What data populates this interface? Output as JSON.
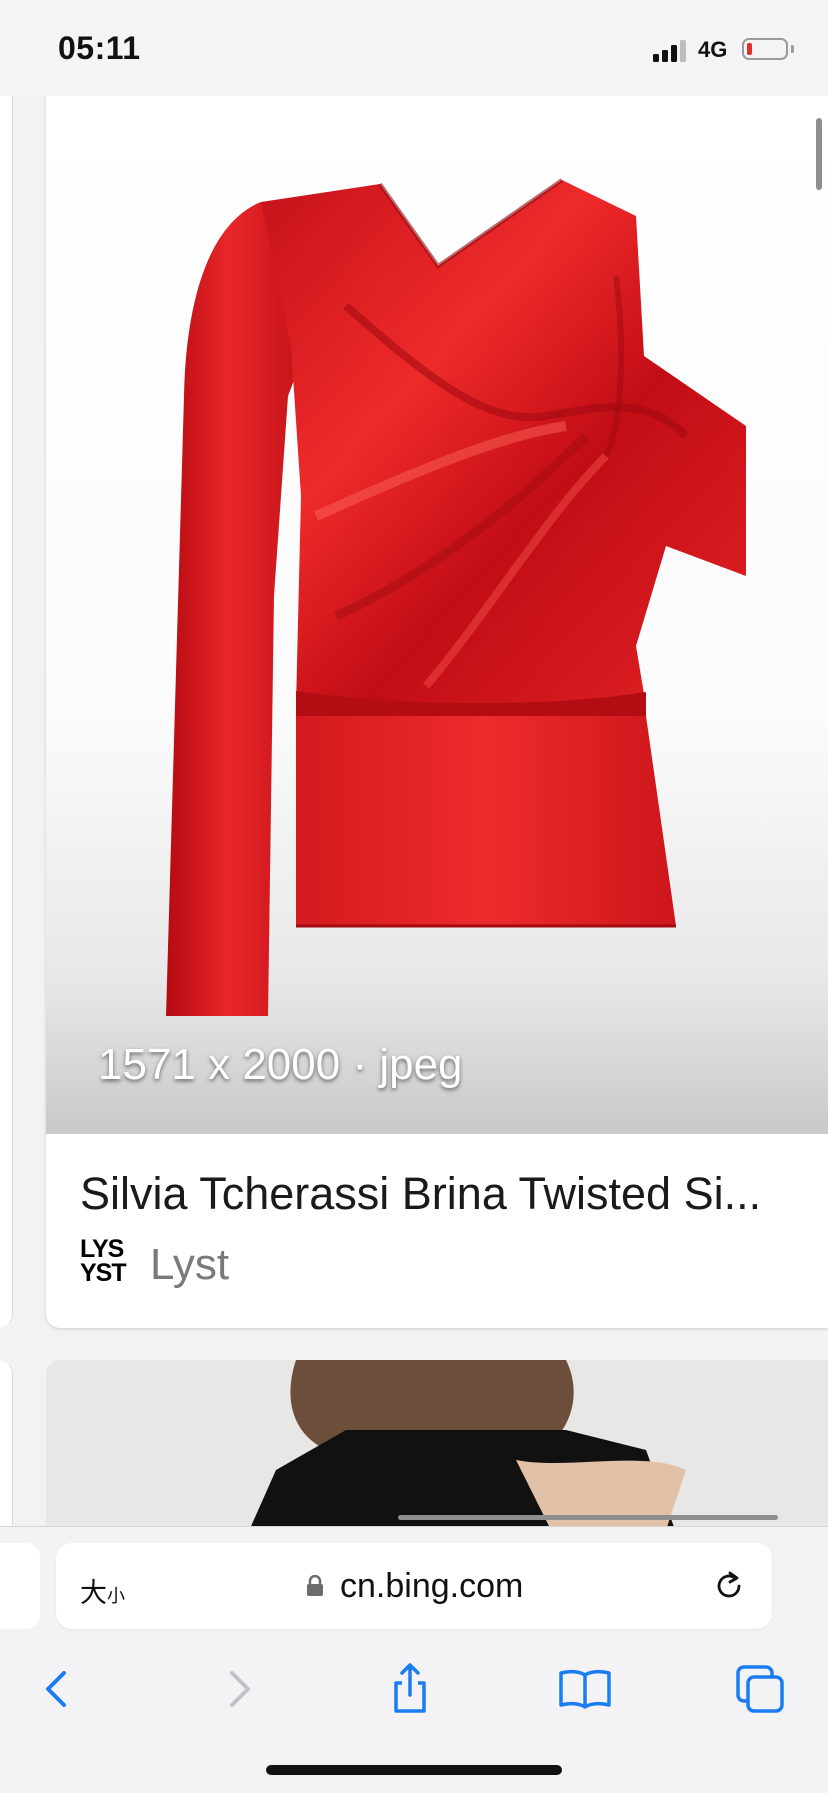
{
  "status_bar": {
    "time": "05:11",
    "network": "4G",
    "signal_bars_active": 3,
    "battery_level_percent": 8
  },
  "result": {
    "image_meta": "1571 x 2000 · jpeg",
    "title": "Silvia Tcherassi Brina Twisted Si...",
    "source_logo": "LYST",
    "source_name": "Lyst"
  },
  "browser": {
    "text_size_label": "大",
    "text_size_small": "小",
    "url": "cn.bing.com",
    "icons": {
      "lock": "lock-icon",
      "reload": "reload-icon",
      "back": "chevron-left-icon",
      "forward": "chevron-right-icon",
      "share": "share-icon",
      "bookmarks": "book-icon",
      "tabs": "tabs-icon"
    }
  },
  "colors": {
    "accent": "#1a7cf2",
    "garment": "#d81a1c",
    "battery_low": "#e0302c"
  }
}
